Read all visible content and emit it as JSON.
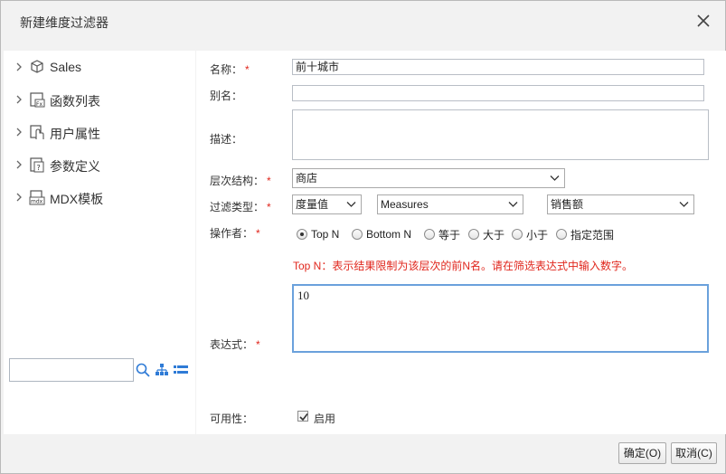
{
  "dialog": {
    "title": "新建维度过滤器"
  },
  "tree": {
    "items": [
      {
        "label": "Sales",
        "icon": "cube-icon"
      },
      {
        "label": "函数列表",
        "icon": "function-icon"
      },
      {
        "label": "用户属性",
        "icon": "user-attribute-icon"
      },
      {
        "label": "参数定义",
        "icon": "parameter-icon"
      },
      {
        "label": "MDX模板",
        "icon": "mdx-template-icon"
      }
    ],
    "search_value": ""
  },
  "form": {
    "name_label": "名称：",
    "name_value": "前十城市",
    "alias_label": "别名：",
    "alias_value": "",
    "desc_label": "描述：",
    "desc_value": "",
    "hierarchy_label": "层次结构：",
    "hierarchy_value": "商店",
    "filter_type_label": "过滤类型：",
    "filter_type_value": "度量值",
    "measures_value": "Measures",
    "measure_value": "销售额",
    "operator_label": "操作者：",
    "operators": [
      {
        "label": "Top N",
        "selected": true
      },
      {
        "label": "Bottom N",
        "selected": false
      },
      {
        "label": "等于",
        "selected": false
      },
      {
        "label": "大于",
        "selected": false
      },
      {
        "label": "小于",
        "selected": false
      },
      {
        "label": "指定范围",
        "selected": false
      }
    ],
    "hint": "Top N：表示结果限制为该层次的前N名。请在筛选表达式中输入数字。",
    "expression_label": "表达式：",
    "expression_value": "10",
    "availability_label": "可用性：",
    "enabled_label": "启用",
    "enabled_checked": true,
    "required_mark": "*"
  },
  "buttons": {
    "ok": "确定(O)",
    "cancel": "取消(C)"
  },
  "colors": {
    "required": "#e0261c",
    "focus_border": "#6aa1dc"
  }
}
